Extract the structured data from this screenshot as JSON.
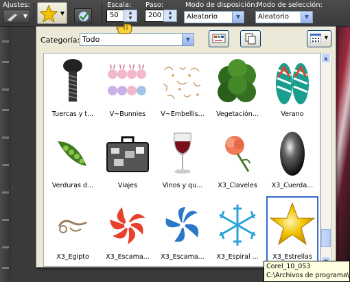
{
  "optbar": {
    "ajustes_label": "Ajustes:",
    "escala_label": "Escala:",
    "escala_value": "50",
    "paso_label": "Paso:",
    "paso_value": "200",
    "disposicion_label": "Modo de disposición:",
    "disposicion_value": "Aleatorio",
    "seleccion_label": "Modo de selección:",
    "seleccion_value": "Aleatorio"
  },
  "panel": {
    "category_label": "Categoría:",
    "category_value": "Todo",
    "items": [
      {
        "label": "Tuercas y t...",
        "icon": "screw-icon"
      },
      {
        "label": "V~Bunnies",
        "icon": "bunnies-icon"
      },
      {
        "label": "V~Embellis...",
        "icon": "embellishment-icon"
      },
      {
        "label": "Vegetación...",
        "icon": "bush-icon"
      },
      {
        "label": "Verano",
        "icon": "flip-flops-icon"
      },
      {
        "label": "Verduras d...",
        "icon": "peas-icon"
      },
      {
        "label": "Viajes",
        "icon": "suitcase-icon"
      },
      {
        "label": "Vinos y qu...",
        "icon": "wine-glass-icon"
      },
      {
        "label": "X3_Claveles",
        "icon": "carnation-icon"
      },
      {
        "label": "X3_Cuerda...",
        "icon": "black-bead-icon"
      },
      {
        "label": "X3_Egipto",
        "icon": "egypt-ornament-icon"
      },
      {
        "label": "X3_Escama...",
        "icon": "red-swirl-icon"
      },
      {
        "label": "X3_Escama...",
        "icon": "blue-swirl-icon"
      },
      {
        "label": "X3_Espiral ...",
        "icon": "spiral-icon"
      },
      {
        "label": "X3_Estrellas",
        "icon": "star-icon"
      }
    ],
    "selected_index": 14
  },
  "tooltip": {
    "line1": "Corel_10_053",
    "line2": "C:\\Archivos de programa\\"
  },
  "colors": {
    "selection": "#316ac5",
    "panel_bg": "#ece9d8",
    "star_gold": "#f2c200"
  }
}
